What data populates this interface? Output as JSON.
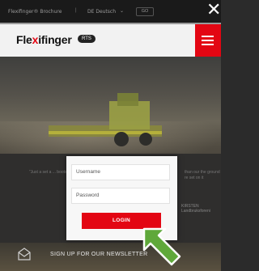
{
  "topbar": {
    "brochure": "Flexifinger® Brochure",
    "divider": "|",
    "lang": "DE Deutsch",
    "go": "GO",
    "close": "✕"
  },
  "header": {
    "logo_main": "Fle",
    "logo_x": "x",
    "logo_rest": "ifinger",
    "logo_badge": "RTS"
  },
  "quote": {
    "text": "\"Just a set a ... boots. We a... clean. I have... before harv...",
    "right_text": "than our the ground re set on it",
    "author": "KIRSTEN",
    "author_sub": "Landbruksforeni"
  },
  "login": {
    "username_placeholder": "Username",
    "password_placeholder": "Password",
    "button": "LOGIN"
  },
  "footer": {
    "newsletter": "SIGN UP FOR OUR NEWSLETTER"
  },
  "colors": {
    "brand_red": "#e30613",
    "arrow_green": "#5fa83a"
  }
}
